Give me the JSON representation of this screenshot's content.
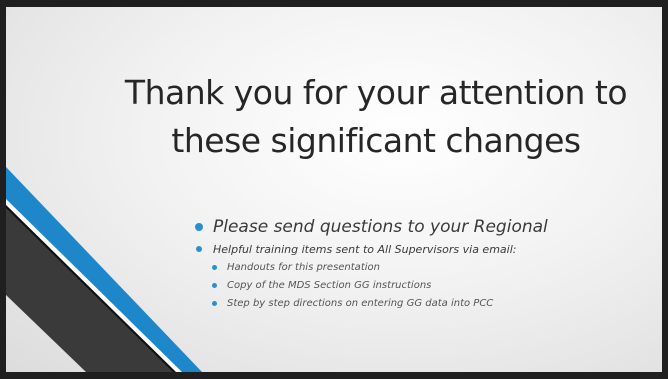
{
  "slide": {
    "title": "Thank you for your attention to these significant changes",
    "bullets": [
      {
        "text": "Please send questions to your Regional",
        "level": 1
      },
      {
        "text": "Helpful training items sent to All Supervisors via email:",
        "level": 2
      },
      {
        "text": "Handouts for this presentation",
        "level": 3
      },
      {
        "text": "Copy of the MDS Section GG instructions",
        "level": 3
      },
      {
        "text": "Step by step directions on entering GG data into PCC",
        "level": 3
      }
    ]
  },
  "colors": {
    "frame": "#1f1f1f",
    "accent_blue": "#1d87c9",
    "accent_dark": "#3a3a3a",
    "title_text": "#262626",
    "bullet_dot": "#2a8fd0"
  }
}
